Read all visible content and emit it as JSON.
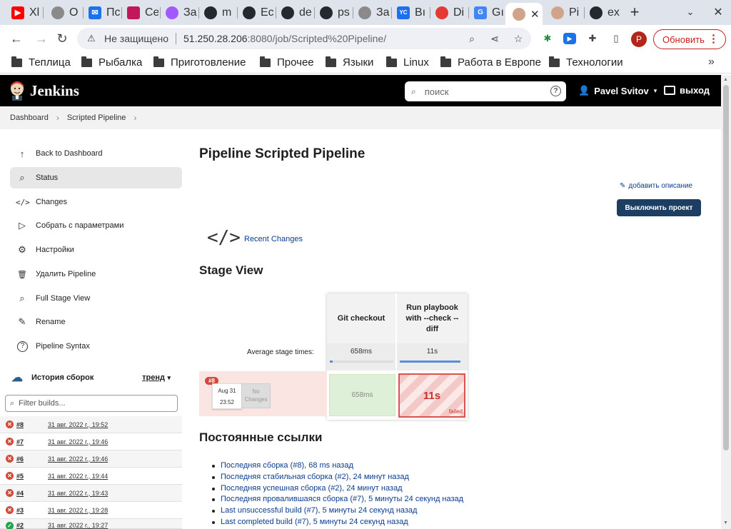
{
  "browser": {
    "tabs": [
      {
        "title": "Xl",
        "icon": "youtube-icon",
        "color": "#ff0000"
      },
      {
        "title": "O",
        "icon": "globe-icon",
        "color": "#8a8a8a"
      },
      {
        "title": "Пс",
        "icon": "mail-icon",
        "color": "#1a73e8"
      },
      {
        "title": "Се",
        "icon": "app-icon",
        "color": "#c2185b"
      },
      {
        "title": "За",
        "icon": "figma-icon",
        "color": "#a259ff"
      },
      {
        "title": "m",
        "icon": "github-icon",
        "color": "#24292f"
      },
      {
        "title": "Ec",
        "icon": "github-icon",
        "color": "#24292f"
      },
      {
        "title": "de",
        "icon": "github-icon",
        "color": "#24292f"
      },
      {
        "title": "ps",
        "icon": "github-icon",
        "color": "#24292f"
      },
      {
        "title": "За",
        "icon": "globe-icon",
        "color": "#8a8a8a"
      },
      {
        "title": "Вı",
        "icon": "yc-icon",
        "color": "#1c6ff0"
      },
      {
        "title": "Di",
        "icon": "app-icon",
        "color": "#e53935"
      },
      {
        "title": "Gı",
        "icon": "translate-icon",
        "color": "#4285f4"
      },
      {
        "title": "",
        "icon": "jenkins-icon",
        "color": "#d0a48a"
      },
      {
        "title": "Pi",
        "icon": "jenkins-icon",
        "color": "#d0a48a"
      },
      {
        "title": "ex",
        "icon": "github-icon",
        "color": "#24292f"
      }
    ],
    "omnibox": {
      "security_label": "Не защищено",
      "url_host": "51.250.28.206",
      "url_path": ":8080/job/Scripted%20Pipeline/"
    },
    "profile_initial": "P",
    "update_label": "Обновить",
    "bookmarks": [
      "Теплица",
      "Рыбалка",
      "Приготовление",
      "Прочее",
      "Языки",
      "Linux",
      "Работа в Европе",
      "Технологии"
    ]
  },
  "jenkins": {
    "title": "Jenkins",
    "search_placeholder": "поиск",
    "help_glyph": "?",
    "user": "Pavel Svitov",
    "logout": "выход",
    "breadcrumbs": [
      "Dashboard",
      "Scripted Pipeline"
    ],
    "sidebar": [
      {
        "label": "Back to Dashboard",
        "icon": "arrow-up-icon",
        "glyph": "↑"
      },
      {
        "label": "Status",
        "icon": "search-icon",
        "glyph": "⌕"
      },
      {
        "label": "Changes",
        "icon": "code-icon",
        "glyph": "</>"
      },
      {
        "label": "Собрать с параметрами",
        "icon": "play-icon",
        "glyph": "▷"
      },
      {
        "label": "Настройки",
        "icon": "gear-icon",
        "glyph": "⚙"
      },
      {
        "label": "Удалить Pipeline",
        "icon": "trash-icon",
        "glyph": "🗑"
      },
      {
        "label": "Full Stage View",
        "icon": "search-icon",
        "glyph": "⌕"
      },
      {
        "label": "Rename",
        "icon": "pencil-icon",
        "glyph": "✎"
      },
      {
        "label": "Pipeline Syntax",
        "icon": "help-icon",
        "glyph": "?"
      }
    ],
    "build_history": {
      "title": "История сборок",
      "trend": "тренд",
      "filter_placeholder": "Filter builds...",
      "builds": [
        {
          "num": "#8",
          "date": "31 авг. 2022 г., 19:52",
          "status": "failed"
        },
        {
          "num": "#7",
          "date": "31 авг. 2022 г., 19:46",
          "status": "failed"
        },
        {
          "num": "#6",
          "date": "31 авг. 2022 г., 19:46",
          "status": "failed"
        },
        {
          "num": "#5",
          "date": "31 авг. 2022 г., 19:44",
          "status": "failed"
        },
        {
          "num": "#4",
          "date": "31 авг. 2022 г., 19:43",
          "status": "failed"
        },
        {
          "num": "#3",
          "date": "31 авг. 2022 г., 19:28",
          "status": "failed"
        },
        {
          "num": "#2",
          "date": "31 авг. 2022 г., 19:27",
          "status": "success"
        }
      ]
    },
    "main": {
      "title": "Pipeline Scripted Pipeline",
      "add_description": "добавить описание",
      "disable_button": "Выключить проект",
      "recent_changes": "Recent Changes",
      "stage_view_title": "Stage View",
      "avg_label": "Average stage times:",
      "stages": [
        {
          "name": "Git checkout",
          "avg": "658ms",
          "avg_fraction": 0.04,
          "run_time": "658ms",
          "run_status": "success"
        },
        {
          "name": "Run playbook with --check --diff",
          "avg": "11s",
          "avg_fraction": 1.0,
          "run_time": "11s",
          "run_status": "failed"
        }
      ],
      "run": {
        "badge": "#8",
        "date": "Aug 31",
        "time": "23:52",
        "no_changes": "No Changes",
        "failed_tag": "failed"
      },
      "permalinks_title": "Постоянные ссылки",
      "permalinks": [
        "Последняя сборка (#8), 68 ms назад",
        "Последняя стабильная сборка (#2), 24 минут назад",
        "Последняя успешная сборка (#2), 24 минут назад",
        "Последняя провалившаяся сборка (#7), 5 минуты 24 секунд назад",
        "Last unsuccessful build (#7), 5 минуты 24 секунд назад",
        "Last completed build (#7), 5 минуты 24 секунд назад"
      ]
    }
  }
}
